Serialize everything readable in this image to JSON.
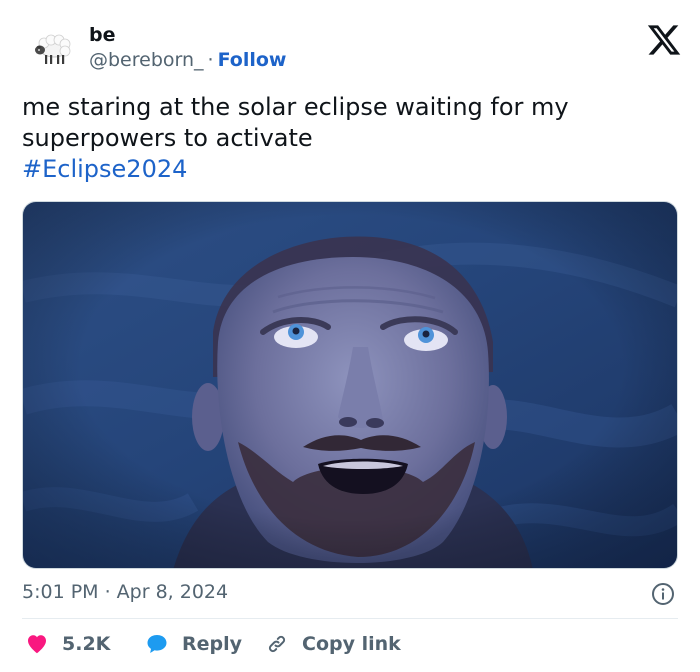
{
  "user": {
    "display_name": "be",
    "handle": "@bereborn_",
    "separator": "·",
    "follow_label": "Follow",
    "avatar_emoji": "🐑",
    "avatar_icon": "sheep-emoji-avatar"
  },
  "tweet": {
    "text_lines": [
      "me staring at the solar eclipse waiting for my",
      "superpowers to activate"
    ],
    "hashtag": "#Eclipse2024",
    "media": {
      "subject": "man looking upward with wide eyes and open mouth in blue-tinted night scene"
    },
    "timestamp": "5:01 PM · Apr 8, 2024"
  },
  "actions": {
    "like": {
      "count": "5.2K",
      "icon": "heart-icon",
      "color": "#f91880"
    },
    "reply": {
      "label": "Reply",
      "icon": "speech-bubble-icon",
      "color": "#1d9bf0"
    },
    "copy_link": {
      "label": "Copy link",
      "icon": "link-icon"
    }
  },
  "icons": {
    "brand": "x-logo-icon",
    "info": "info-icon"
  },
  "colors": {
    "link_blue": "#1d63c9",
    "secondary_text": "#536471",
    "primary_text": "#0f1419",
    "like_pink": "#f91880",
    "reply_blue": "#1d9bf0"
  }
}
